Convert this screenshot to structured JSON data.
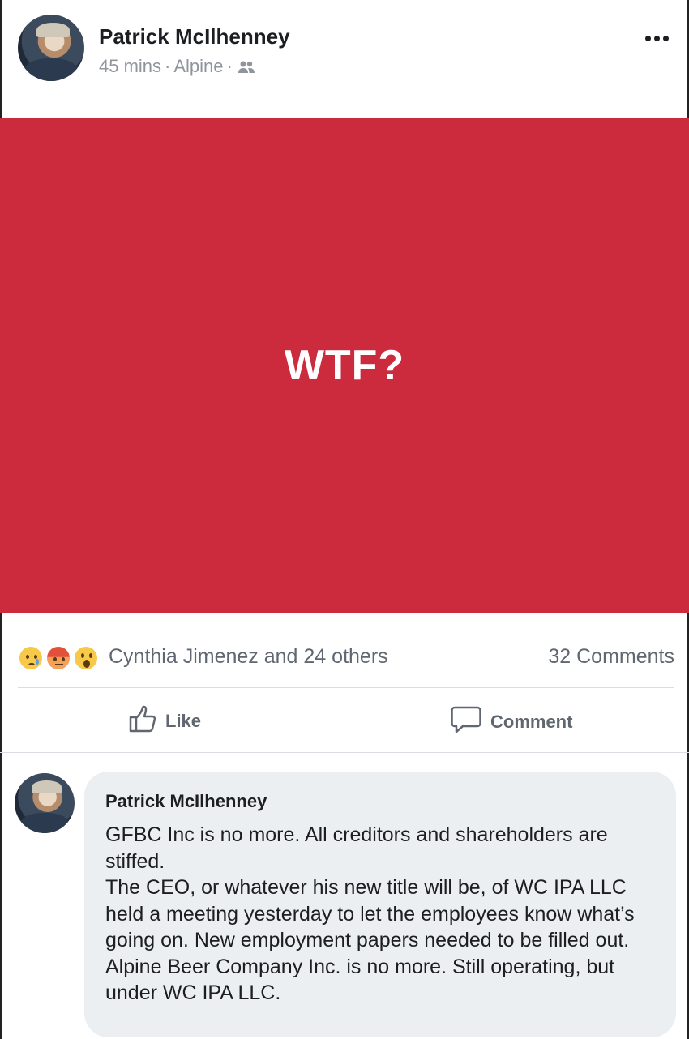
{
  "post": {
    "author": "Patrick McIlhenney",
    "time": "45 mins",
    "separator": "·",
    "group": "Alpine",
    "audience_icon": "people-icon",
    "more_icon": "more-options-icon"
  },
  "banner": {
    "text": "WTF?",
    "background_color": "#cc2b3d"
  },
  "stats": {
    "reaction_icons": [
      "sad-reaction-icon",
      "angry-reaction-icon",
      "wow-reaction-icon"
    ],
    "reactors": "Cynthia Jimenez and 24 others",
    "comments": "32 Comments"
  },
  "actions": {
    "like_label": "Like",
    "comment_label": "Comment"
  },
  "comment": {
    "author": "Patrick McIlhenney",
    "text": "GFBC Inc is no more. All creditors and shareholders are stiffed.\nThe CEO, or whatever his new title will be, of WC IPA LLC held a meeting yesterday to let the employees know what’s going on. New employment papers needed to be filled out. Alpine Beer Company Inc. is no more. Still operating, but under WC IPA LLC."
  }
}
